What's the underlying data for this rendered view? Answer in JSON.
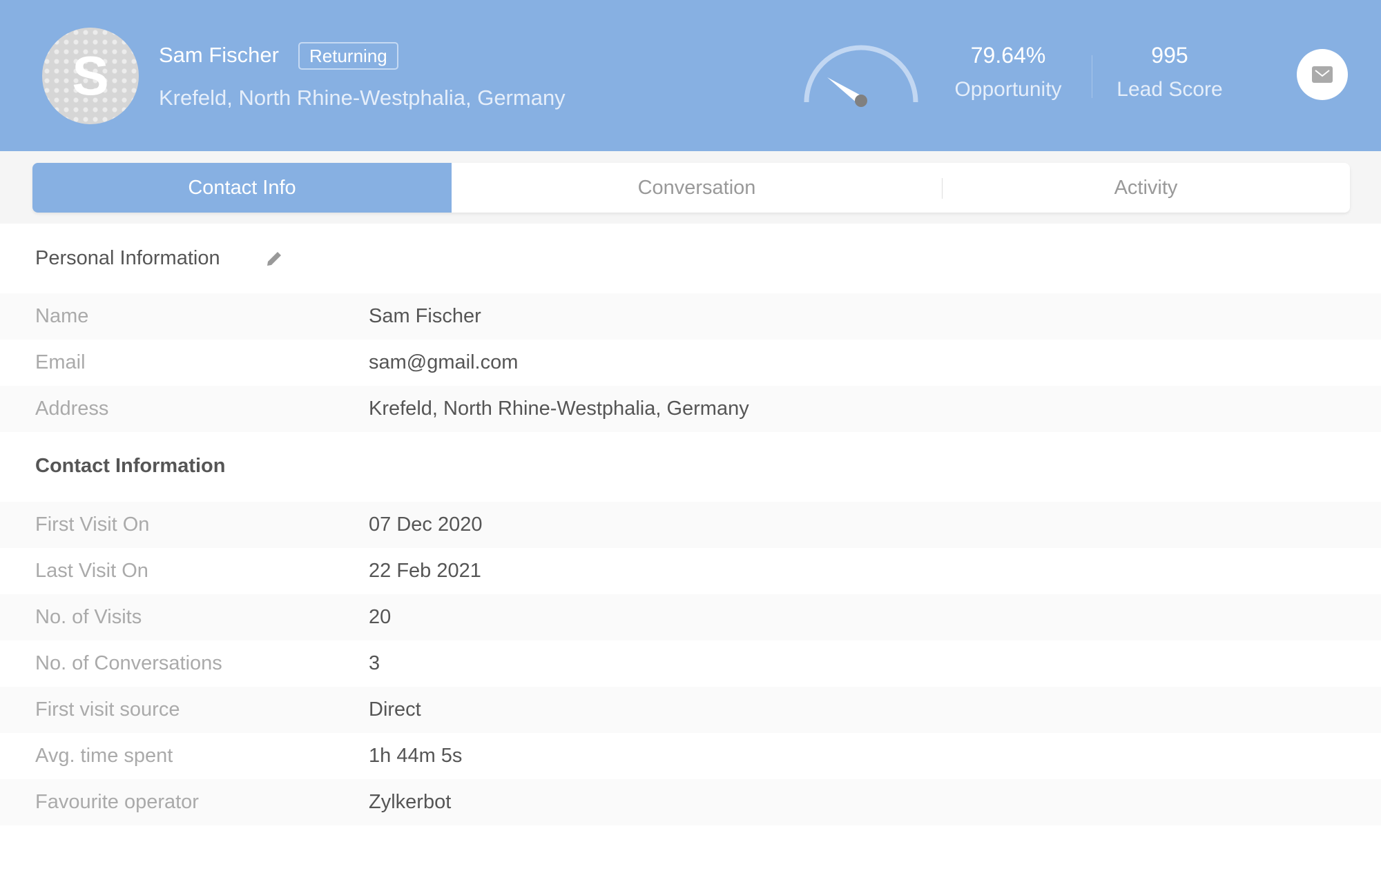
{
  "header": {
    "avatar_initial": "S",
    "name": "Sam Fischer",
    "badge": "Returning",
    "location": "Krefeld, North Rhine-Westphalia, Germany",
    "opportunity_value": "79.64%",
    "opportunity_label": "Opportunity",
    "opportunity_fraction": 0.7964,
    "lead_score_value": "995",
    "lead_score_label": "Lead Score"
  },
  "tabs": [
    {
      "label": "Contact Info",
      "active": true
    },
    {
      "label": "Conversation"
    },
    {
      "label": "Activity"
    }
  ],
  "personal": {
    "title": "Personal Information",
    "rows": [
      {
        "label": "Name",
        "value": "Sam Fischer"
      },
      {
        "label": "Email",
        "value": "sam@gmail.com"
      },
      {
        "label": "Address",
        "value": "Krefeld, North Rhine-Westphalia, Germany"
      }
    ]
  },
  "contact": {
    "title": "Contact Information",
    "rows": [
      {
        "label": "First Visit On",
        "value": "07 Dec 2020"
      },
      {
        "label": "Last Visit On",
        "value": "22 Feb 2021"
      },
      {
        "label": "No. of Visits",
        "value": "20"
      },
      {
        "label": "No. of Conversations",
        "value": "3"
      },
      {
        "label": "First visit source",
        "value": "Direct"
      },
      {
        "label": "Avg. time spent",
        "value": "1h 44m 5s"
      },
      {
        "label": "Favourite operator",
        "value": "Zylkerbot"
      }
    ]
  }
}
